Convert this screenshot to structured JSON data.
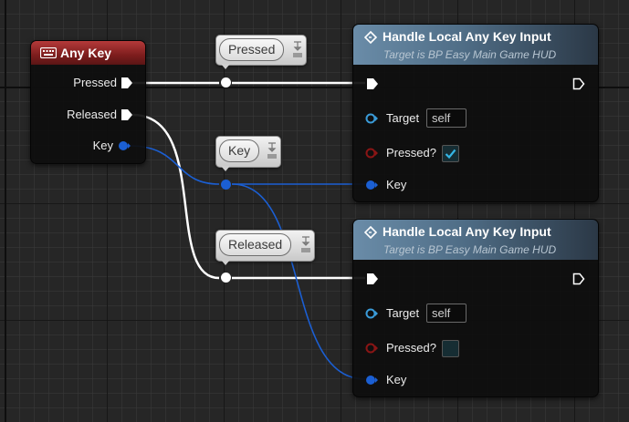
{
  "any_key_node": {
    "title": "Any Key",
    "pins": [
      "Pressed",
      "Released",
      "Key"
    ]
  },
  "reroutes": [
    {
      "label": "Pressed"
    },
    {
      "label": "Key"
    },
    {
      "label": "Released"
    }
  ],
  "handle_nodes": [
    {
      "title": "Handle Local Any Key Input",
      "subtitle": "Target is BP Easy Main Game HUD",
      "target_label": "Target",
      "target_value": "self",
      "pressed_label": "Pressed?",
      "pressed_checked": true,
      "key_label": "Key"
    },
    {
      "title": "Handle Local Any Key Input",
      "subtitle": "Target is BP Easy Main Game HUD",
      "target_label": "Target",
      "target_value": "self",
      "pressed_label": "Pressed?",
      "pressed_checked": false,
      "key_label": "Key"
    }
  ],
  "colors": {
    "exec_wire": "#ffffff",
    "key_wire": "#1b5fd3",
    "target_pin": "#3a9bd8",
    "bool_pin": "#8a1515",
    "check": "#35b6e6"
  }
}
